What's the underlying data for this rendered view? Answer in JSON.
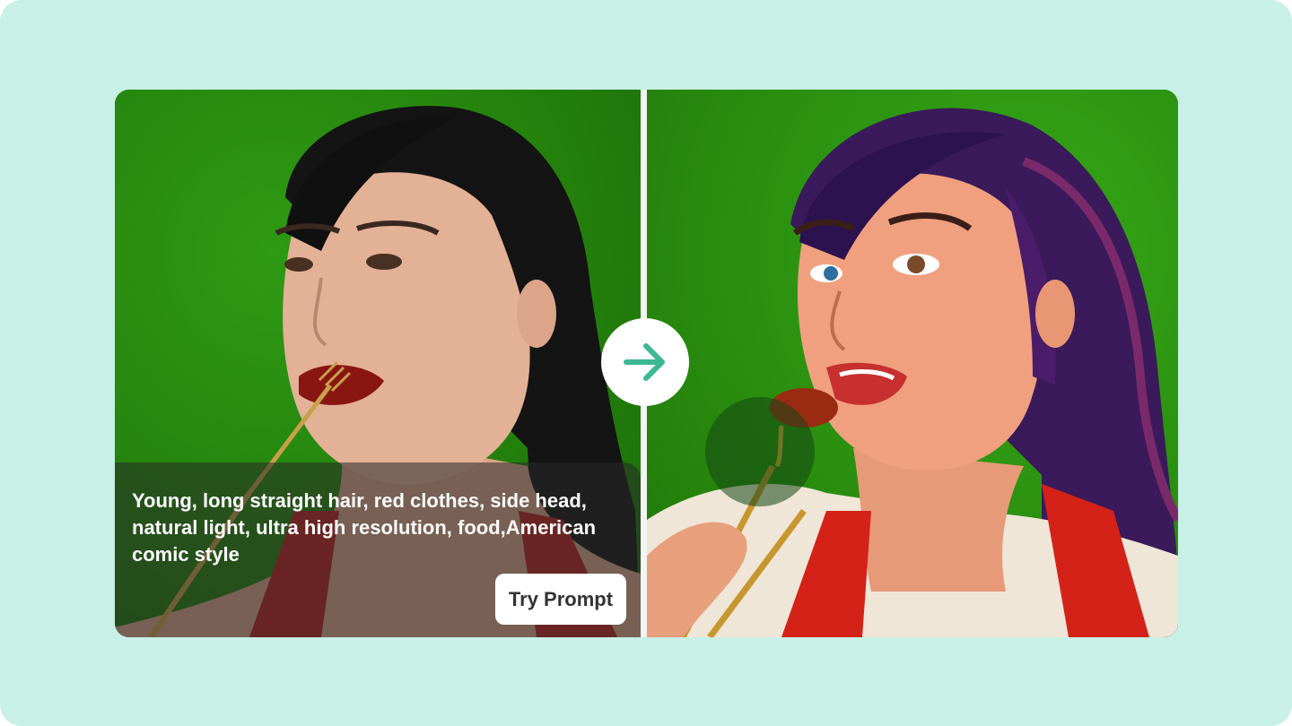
{
  "prompt": {
    "text": "Young, long straight hair, red clothes, side head, natural light, ultra high resolution, food,American comic style",
    "button_label": "Try Prompt"
  },
  "images": {
    "original": "photo-woman-eating-with-fork-green-background",
    "stylized": "american-comic-style-woman-eating-green-background"
  },
  "icons": {
    "transform": "arrow-right-icon"
  },
  "colors": {
    "page_background": "#c8f0e6",
    "accent": "#3cb894",
    "button_bg": "#ffffff"
  }
}
